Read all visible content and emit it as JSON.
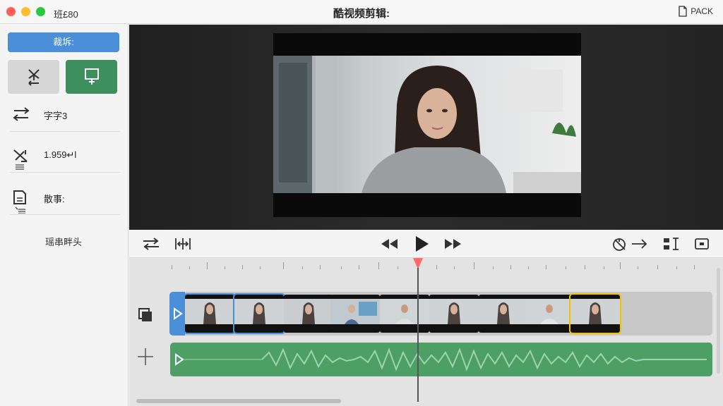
{
  "window": {
    "app_name": "班£80",
    "title": "酷视频剪辑:",
    "export_label": "PACK"
  },
  "sidebar": {
    "crop_button": "裁坼:",
    "rows": [
      {
        "label": "字字3",
        "icon": "swap-arrows-icon"
      },
      {
        "label": "1.959↵l",
        "icon": "speed-icon"
      },
      {
        "label": "散事:",
        "icon": "document-icon"
      }
    ],
    "footer": "瑶串畔头"
  },
  "colors": {
    "accent": "#4a8fd8",
    "green": "#3d8f5e",
    "playhead": "#ff6b6b",
    "audio": "#4e9f66",
    "selected_clip": "#f2c200"
  }
}
